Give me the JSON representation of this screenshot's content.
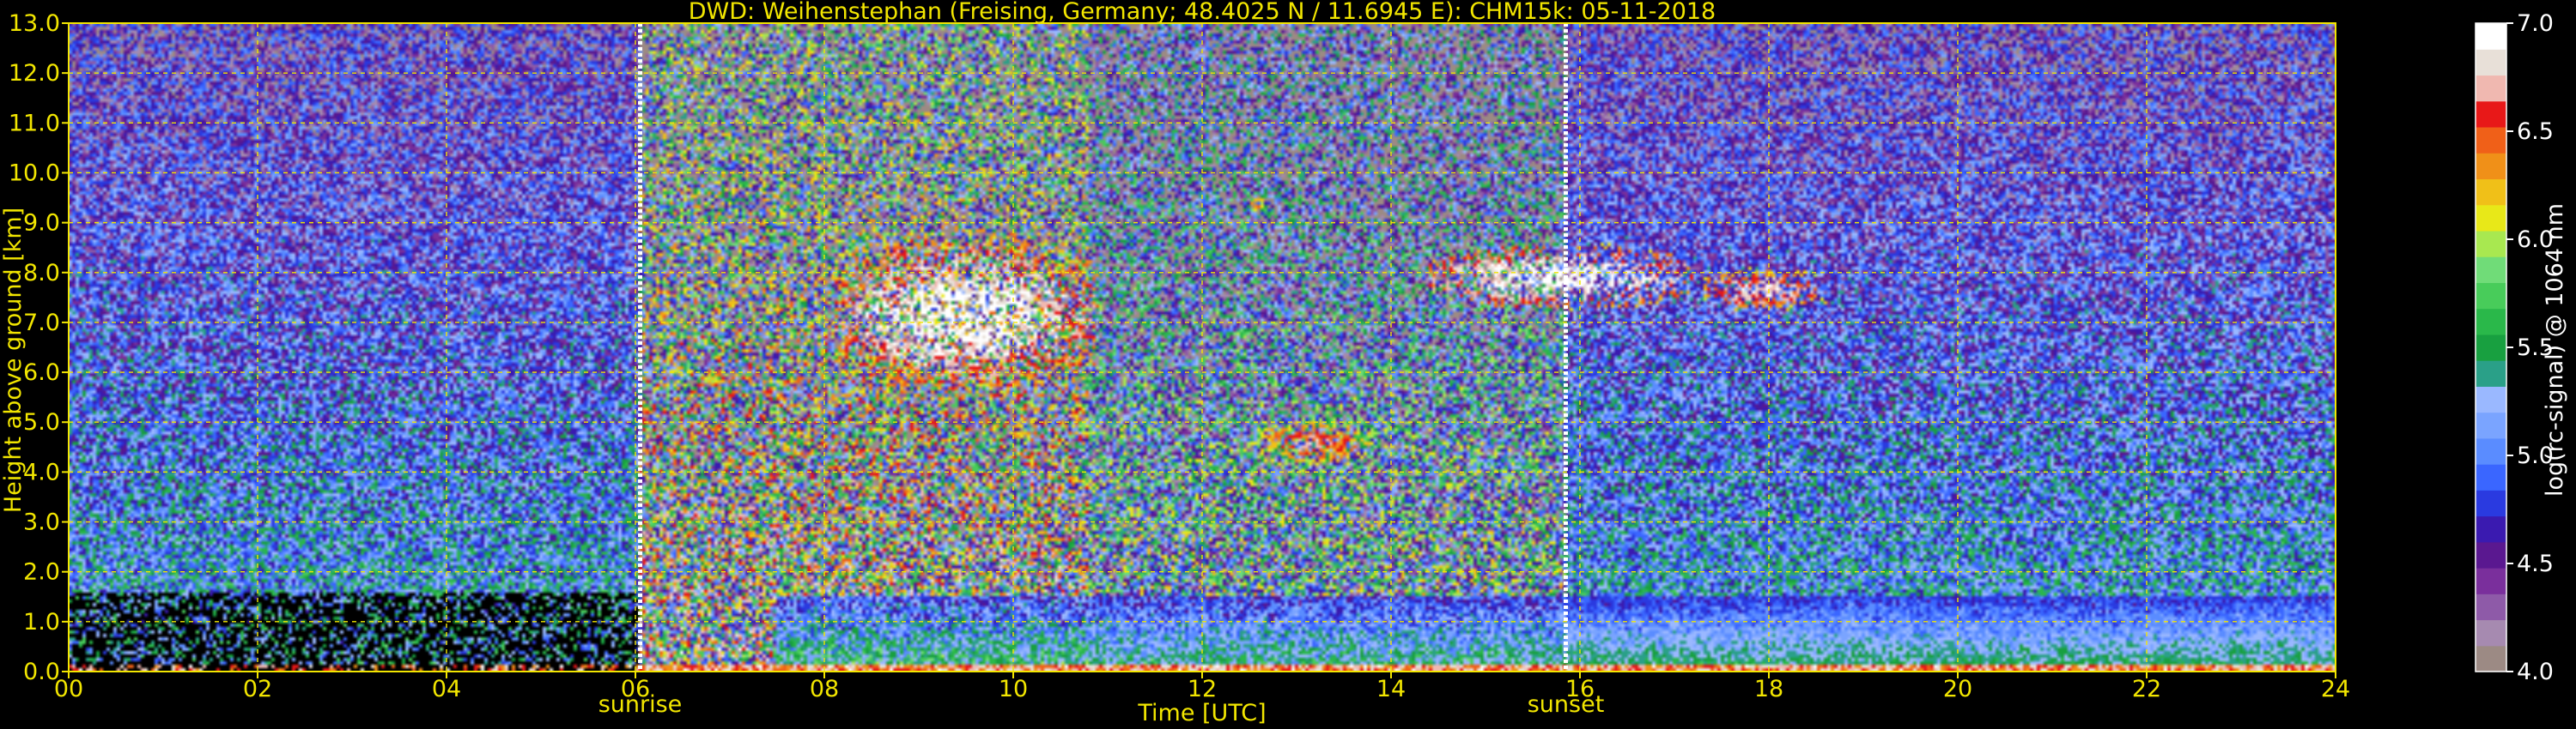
{
  "chart_data": {
    "type": "heatmap",
    "title": "DWD: Weihenstephan (Freising, Germany; 48.4025 N / 11.6945 E):    CHM15k: 05-11-2018",
    "xlabel": "Time [UTC]",
    "ylabel": "Height above ground [km]",
    "xlim": [
      0,
      24
    ],
    "ylim": [
      0,
      13
    ],
    "x_ticks": [
      "00",
      "02",
      "04",
      "06",
      "08",
      "10",
      "12",
      "14",
      "16",
      "18",
      "20",
      "22",
      "24"
    ],
    "y_ticks": [
      "0.0",
      "1.0",
      "2.0",
      "3.0",
      "4.0",
      "5.0",
      "6.0",
      "7.0",
      "8.0",
      "9.0",
      "10.0",
      "11.0",
      "12.0",
      "13.0"
    ],
    "grid": true,
    "markers": [
      {
        "label": "sunrise",
        "time": 6.05
      },
      {
        "label": "sunset",
        "time": 15.85
      }
    ],
    "colorbar": {
      "label": "log(rc-signal) @ 1064 nm",
      "range": [
        4.0,
        7.0
      ],
      "ticks": [
        "4.0",
        "4.5",
        "5.0",
        "5.5",
        "6.0",
        "6.5",
        "7.0"
      ],
      "colors": [
        "#9c8a84",
        "#a68ab0",
        "#8e5aa8",
        "#7a2f9c",
        "#5a1890",
        "#3a1ab0",
        "#2a3ae0",
        "#3a66ff",
        "#5a8cff",
        "#7aa4ff",
        "#9ab8ff",
        "#2aa088",
        "#18a040",
        "#2ab84a",
        "#48cc5a",
        "#70dc78",
        "#a8e850",
        "#e8e818",
        "#f0c018",
        "#f09018",
        "#f06018",
        "#e81818",
        "#f0b8b0",
        "#e8e0d8",
        "#ffffff"
      ]
    },
    "features": [
      {
        "kind": "cirrus cloud",
        "t_start": 8.1,
        "t_end": 10.9,
        "h_min": 5.4,
        "h_max": 8.9,
        "intensity": 7.0
      },
      {
        "kind": "cirrus cloud",
        "t_start": 12.5,
        "t_end": 12.65,
        "h_min": 9.2,
        "h_max": 9.6,
        "intensity": 6.5
      },
      {
        "kind": "mid-level cloud",
        "t_start": 12.6,
        "t_end": 13.8,
        "h_min": 4.1,
        "h_max": 5.1,
        "intensity": 6.6
      },
      {
        "kind": "cirrus cloud",
        "t_start": 14.4,
        "t_end": 17.2,
        "h_min": 7.2,
        "h_max": 8.6,
        "intensity": 7.0
      },
      {
        "kind": "cirrus cloud",
        "t_start": 17.3,
        "t_end": 18.6,
        "h_min": 7.2,
        "h_max": 8.1,
        "intensity": 6.8
      },
      {
        "kind": "boundary layer",
        "t_start": 7.5,
        "t_end": 24.0,
        "h_min": 0.0,
        "h_max": 1.5,
        "intensity": 5.0
      }
    ]
  }
}
